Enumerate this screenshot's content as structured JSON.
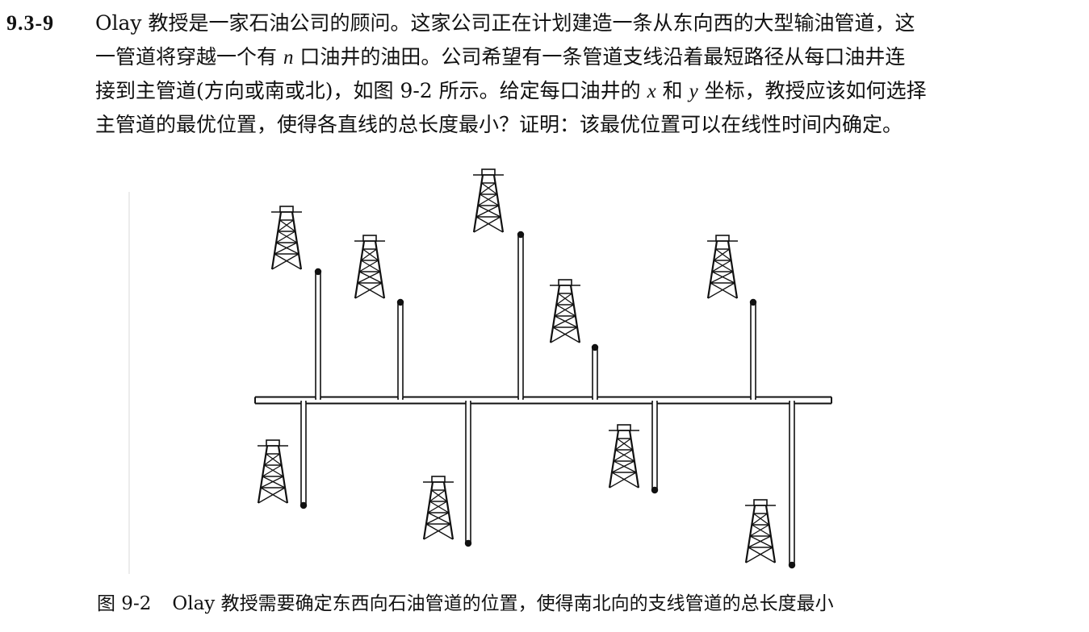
{
  "problem": {
    "number": "9.3-9",
    "lines": [
      [
        "Olay 教授是一家石油公司的顾问。这家公司正在计划建造一条从东向西的大型输油管道，这"
      ],
      [
        "一管道将穿越一个有 ",
        "n",
        " 口油井的油田。公司希望有一条管道支线沿着最短路径从每口油井连"
      ],
      [
        "接到主管道(方向或南或北)，如图 9-2 所示。给定每口油井的 ",
        "x",
        " 和 ",
        "y",
        " 坐标，教授应该如何选择"
      ],
      [
        "主管道的最优位置，使得各直线的总长度最小？证明：该最优位置可以在线性时间内确定。"
      ]
    ]
  },
  "figure": {
    "caption_label": "图 9-2",
    "caption_text": "Olay 教授需要确定东西向石油管道的位置，使得南北向的支线管道的总长度最小"
  }
}
